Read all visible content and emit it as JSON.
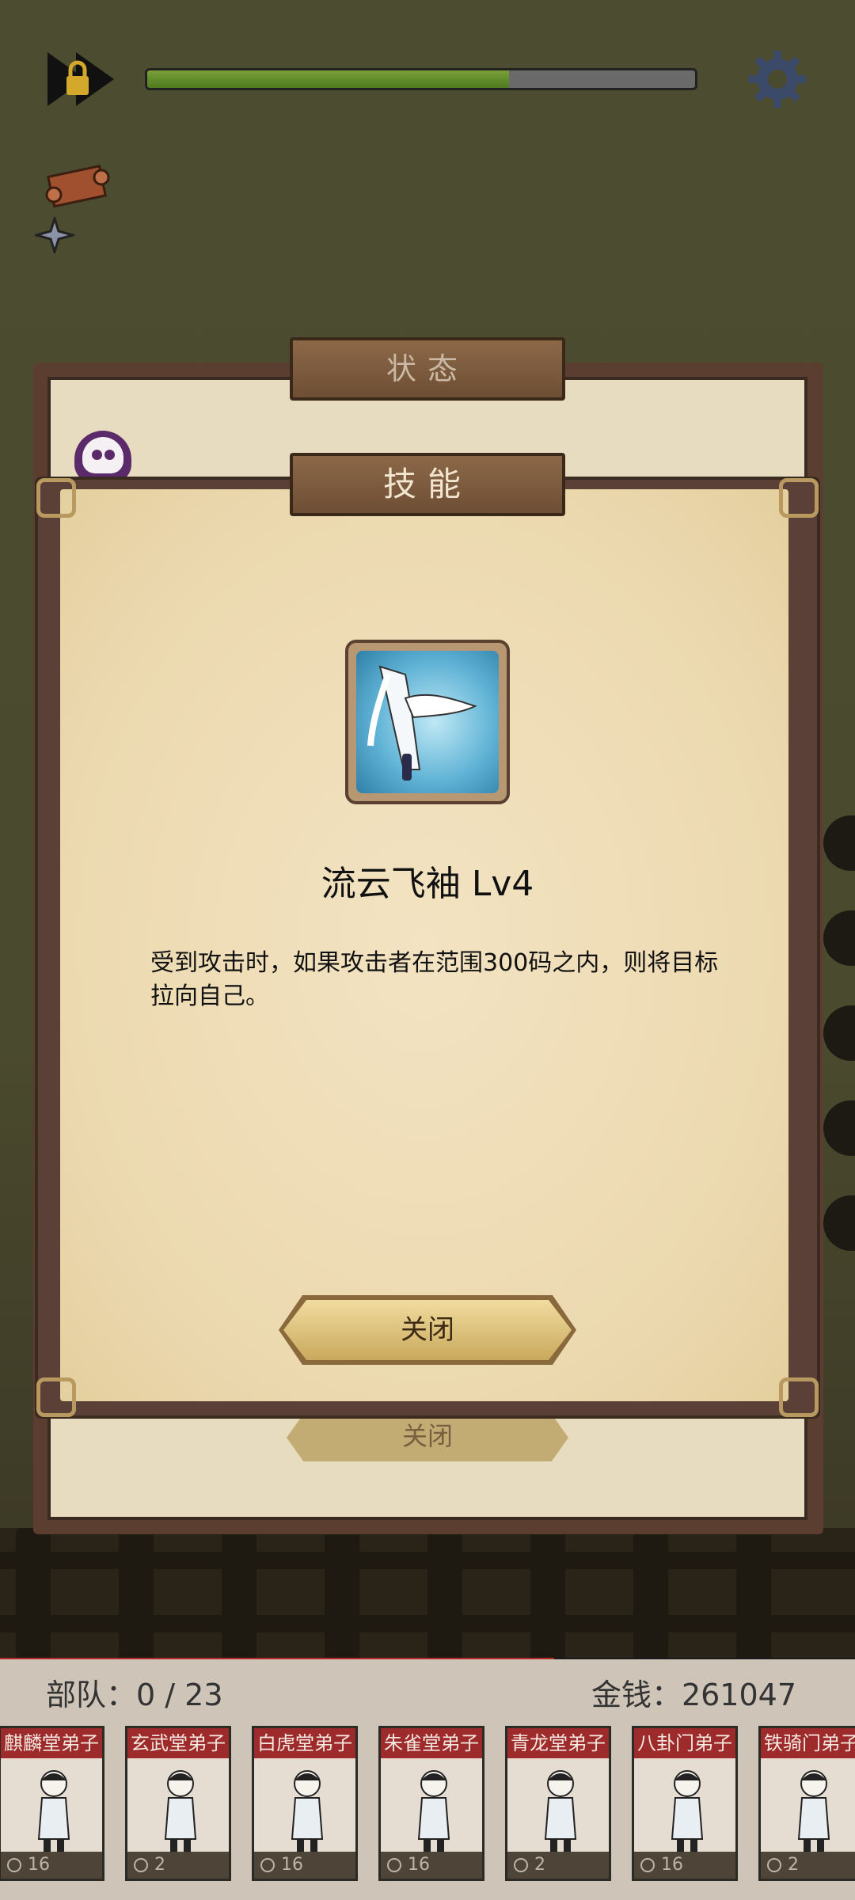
{
  "hud": {
    "progress_fraction": 0.66
  },
  "status_panel": {
    "title": "状态",
    "close_label": "关闭"
  },
  "skill_dialog": {
    "title": "技能",
    "skill_name": "流云飞袖 Lv4",
    "description": "受到攻击时，如果攻击者在范围300码之内，则将目标拉向自己。",
    "close_label": "关闭"
  },
  "bottom": {
    "troops_label": "部队：0 / 23",
    "money_label": "金钱：261047",
    "units": [
      {
        "name": "麒麟堂弟子",
        "cost": "16"
      },
      {
        "name": "玄武堂弟子",
        "cost": "2"
      },
      {
        "name": "白虎堂弟子",
        "cost": "16"
      },
      {
        "name": "朱雀堂弟子",
        "cost": "16"
      },
      {
        "name": "青龙堂弟子",
        "cost": "2"
      },
      {
        "name": "八卦门弟子",
        "cost": "16"
      },
      {
        "name": "铁骑门弟子",
        "cost": "2"
      }
    ]
  },
  "colors": {
    "plank": "#7a5a3e",
    "paper": "#ecd9b0",
    "unit_name_bg": "#9e2b2b",
    "progress_fill": "#6a8f2e"
  },
  "icons": [
    "lock-play-icon",
    "gear-icon",
    "scroll-icon",
    "shuriken-icon",
    "skull-icon",
    "skill-flowing-sleeve-icon",
    "coin-icon"
  ]
}
